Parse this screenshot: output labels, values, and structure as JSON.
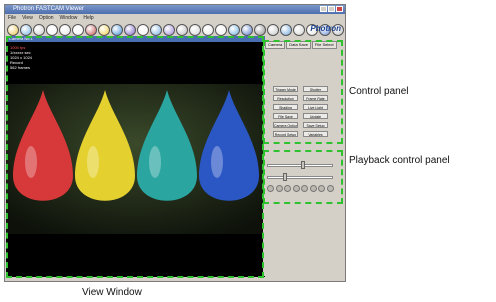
{
  "window": {
    "title": "Photron FASTCAM Viewer",
    "menus": [
      "File",
      "View",
      "Option",
      "Window",
      "Help"
    ],
    "brand": "Photron"
  },
  "toolbar_icon_colors": [
    "#e9c64a",
    "#7ab3e0",
    "#cfcfcf",
    "#f2f2f2",
    "#e7e7e7",
    "#f5f5f5",
    "#c75353",
    "#f0d24a",
    "#3e8fd8",
    "#7e66c8",
    "#f4f4f4",
    "#78b1e6",
    "#9e8ad8",
    "#bdbdbd",
    "#d6d6d6",
    "#e6e6e6",
    "#f0f0f0",
    "#6db0e0",
    "#5579c9",
    "#8f8f8f",
    "#c9c9c9",
    "#74a7dd",
    "#d5d5d5",
    "#e7e7e7",
    "#6b8fd7",
    "#c2c2c2"
  ],
  "view_window": {
    "header": "Camera No.1",
    "info_lines": [
      "1000 fps",
      "1/xxxxx sec",
      "1024 x 1024",
      "Record",
      "562 frames"
    ],
    "balloon_colors": [
      "#d7383a",
      "#e4d130",
      "#2aa5a0",
      "#2b57c4"
    ]
  },
  "control_panel": {
    "tabs": [
      "Camera",
      "Data Save",
      "File Select"
    ],
    "buttons": [
      "Trigger Mode",
      "Shutter",
      "Resolution",
      "Frame Rate",
      "Shading",
      "Live Light",
      "File Save",
      "Update",
      "Camera Option",
      "Save Setup",
      "Record Setup",
      "Variables"
    ]
  },
  "playback_panel": {
    "sliders": 2
  },
  "annotations": {
    "control_panel": "Control panel",
    "playback_control_panel": "Playback control panel",
    "view_window": "View Window"
  },
  "colors": {
    "highlight": "#2fc22f",
    "titlebar": "#4d6fad"
  }
}
